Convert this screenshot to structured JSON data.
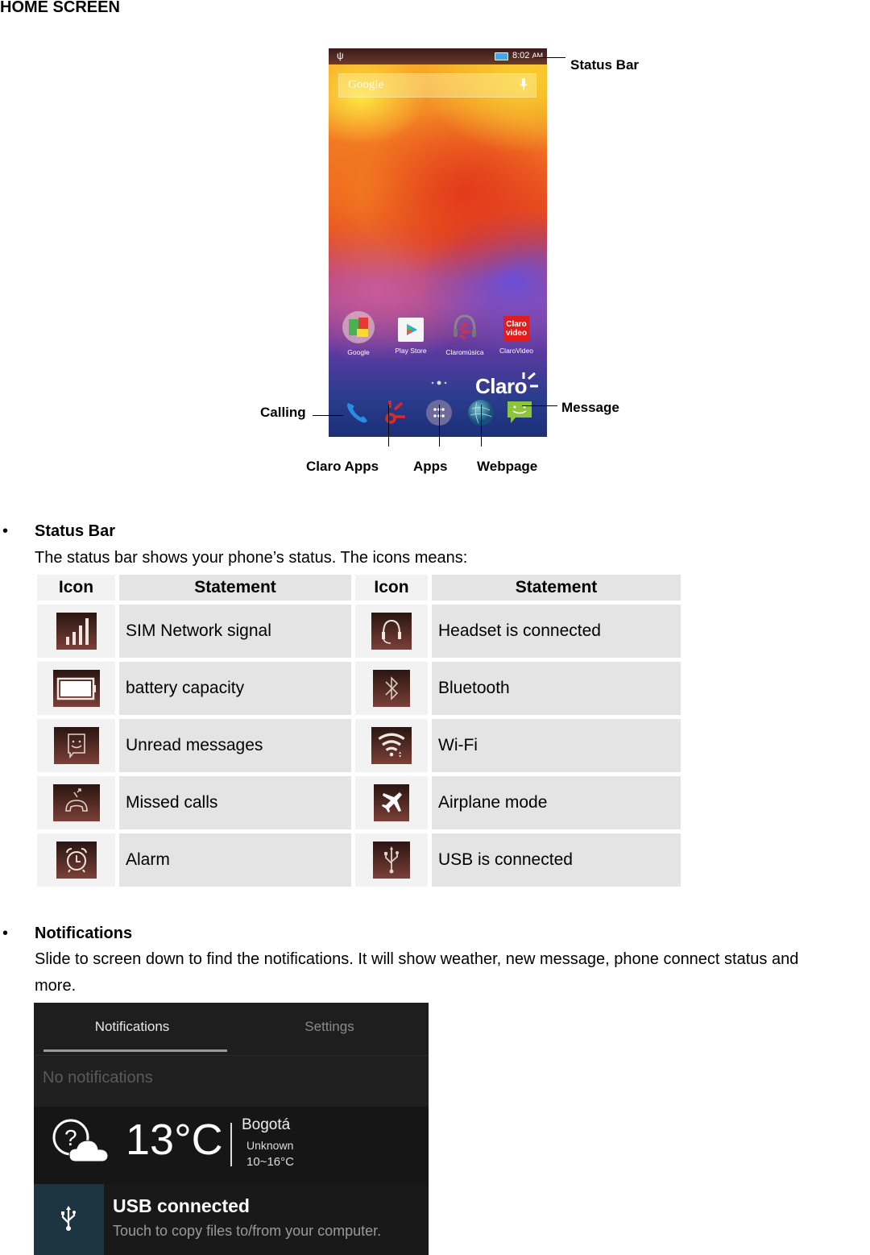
{
  "document": {
    "title": "HOME SCREEN"
  },
  "phone": {
    "status_bar": {
      "usb_icon": "usb-icon",
      "battery_icon": "battery-icon",
      "time": "8:02",
      "ampm": "AM"
    },
    "search": {
      "label": "Google",
      "mic_icon": "microphone-icon"
    },
    "apps": [
      {
        "label": "Google",
        "icon": "google-folder-icon"
      },
      {
        "label": "Play Store",
        "icon": "play-store-icon"
      },
      {
        "label": "Claromúsica",
        "icon": "claromusica-icon"
      },
      {
        "label": "ClaroVideo",
        "icon": "clarovideo-icon",
        "icon_text_1": "Claro",
        "icon_text_2": "video"
      }
    ],
    "brand": "Claro",
    "dock": [
      {
        "icon": "phone-icon",
        "name": "Calling"
      },
      {
        "icon": "claro-apps-icon",
        "name": "Claro Apps"
      },
      {
        "icon": "app-drawer-icon",
        "name": "Apps"
      },
      {
        "icon": "globe-icon",
        "name": "Webpage"
      },
      {
        "icon": "message-icon",
        "name": "Message"
      }
    ]
  },
  "callouts": {
    "status_bar": "Status Bar",
    "calling": "Calling",
    "message": "Message",
    "claro_apps": "Claro Apps",
    "apps": "Apps",
    "webpage": "Webpage"
  },
  "status_section": {
    "bullet": "•",
    "heading": "Status Bar",
    "description": "The status bar shows your phone’s status. The icons means:",
    "table": {
      "headers": [
        "Icon",
        "Statement",
        "Icon",
        "Statement"
      ],
      "rows": [
        {
          "left_icon": "signal-icon",
          "left_text": "SIM Network signal",
          "right_icon": "headset-icon",
          "right_text": "Headset is connected"
        },
        {
          "left_icon": "battery-icon",
          "left_text": "battery capacity",
          "right_icon": "bluetooth-icon",
          "right_text": "Bluetooth"
        },
        {
          "left_icon": "unread-message-icon",
          "left_text": "Unread messages",
          "right_icon": "wifi-icon",
          "right_text": "Wi-Fi"
        },
        {
          "left_icon": "missed-call-icon",
          "left_text": "Missed calls",
          "right_icon": "airplane-icon",
          "right_text": "Airplane mode"
        },
        {
          "left_icon": "alarm-icon",
          "left_text": "Alarm",
          "right_icon": "usb-icon",
          "right_text": "USB is connected"
        }
      ]
    }
  },
  "notifications_section": {
    "bullet": "•",
    "heading": "Notifications",
    "description_line1": "Slide to screen down to find the notifications. It will show weather, new message, phone connect status and",
    "description_line2": "more.",
    "panel": {
      "tabs": [
        "Notifications",
        "Settings"
      ],
      "active_tab": "Notifications",
      "empty_text": "No notifications",
      "weather": {
        "icon": "unknown-weather-cloud-icon",
        "temperature": "13°C",
        "city": "Bogotá",
        "condition": "Unknown",
        "range": "10~16°C"
      },
      "usb_notification": {
        "icon": "usb-icon",
        "title": "USB connected",
        "subtitle": "Touch to copy files to/from your computer."
      }
    }
  }
}
